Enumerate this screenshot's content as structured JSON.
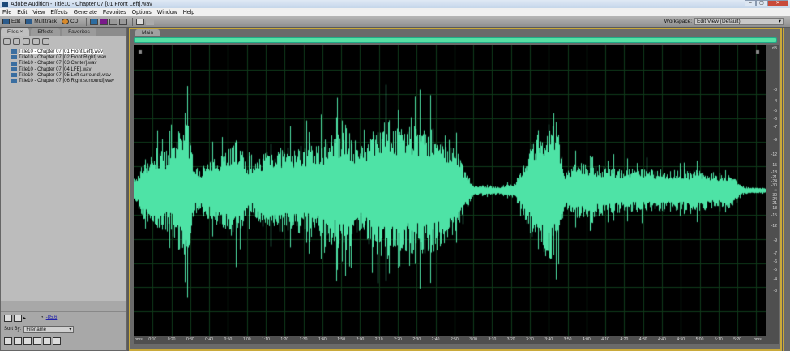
{
  "window": {
    "title": "Adobe Audition - Title10 - Chapter 07 [01 Front Left].wav",
    "controls": [
      "–",
      "▢",
      "✕"
    ]
  },
  "menu": [
    "File",
    "Edit",
    "View",
    "Effects",
    "Generate",
    "Favorites",
    "Options",
    "Window",
    "Help"
  ],
  "toolbar": {
    "edit": "Edit",
    "multitrack": "Multitrack",
    "cd": "CD",
    "workspace_label": "Workspace:",
    "workspace_value": "Edit View (Default)"
  },
  "left_panel": {
    "tabs": [
      "Files ×",
      "Effects",
      "Favorites"
    ],
    "files": [
      "Title10 - Chapter 07 [01 Front Left].wav",
      "Title10 - Chapter 07 [02 Front Right].wav",
      "Title10 - Chapter 07 [03 Center].wav",
      "Title10 - Chapter 07 [04 LFE].wav",
      "Title10 - Chapter 07 [05 Left surround].wav",
      "Title10 - Chapter 07 [06 Right surround].wav"
    ],
    "volume": "-85.6",
    "sort_label": "Sort By:",
    "sort_value": "Filename"
  },
  "main_panel": {
    "tab": "Main"
  },
  "chart_data": {
    "type": "area",
    "title": "Waveform",
    "x_unit": "seconds",
    "envelope": [
      [
        0,
        0.05
      ],
      [
        5,
        0.2
      ],
      [
        10,
        0.25
      ],
      [
        20,
        0.3
      ],
      [
        28,
        0.55
      ],
      [
        32,
        0.15
      ],
      [
        40,
        0.2
      ],
      [
        48,
        0.3
      ],
      [
        55,
        0.35
      ],
      [
        62,
        0.15
      ],
      [
        70,
        0.3
      ],
      [
        80,
        0.3
      ],
      [
        90,
        0.3
      ],
      [
        100,
        0.35
      ],
      [
        112,
        0.45
      ],
      [
        120,
        0.3
      ],
      [
        130,
        0.5
      ],
      [
        145,
        0.45
      ],
      [
        155,
        0.45
      ],
      [
        165,
        0.4
      ],
      [
        172,
        0.25
      ],
      [
        180,
        0.03
      ],
      [
        195,
        0.02
      ],
      [
        202,
        0.05
      ],
      [
        210,
        0.3
      ],
      [
        215,
        0.45
      ],
      [
        220,
        0.5
      ],
      [
        225,
        0.4
      ],
      [
        228,
        0.12
      ],
      [
        235,
        0.2
      ],
      [
        260,
        0.15
      ],
      [
        300,
        0.14
      ],
      [
        318,
        0.1
      ],
      [
        322,
        0.02
      ],
      [
        335,
        0.01
      ]
    ],
    "xlim": [
      0,
      335
    ],
    "time_ticks": [
      "hms",
      "0:10",
      "0:20",
      "0:30",
      "0:40",
      "0:50",
      "1:00",
      "1:10",
      "1:20",
      "1:30",
      "1:40",
      "1:50",
      "2:00",
      "2:10",
      "2:20",
      "2:30",
      "2:40",
      "2:50",
      "3:00",
      "3:10",
      "3:20",
      "3:30",
      "3:40",
      "3:50",
      "4:00",
      "4:10",
      "4:20",
      "4:30",
      "4:40",
      "4:50",
      "5:00",
      "5:10",
      "5:20",
      "hms"
    ],
    "db_ticks": [
      "dB",
      "-3",
      "-4",
      "-5",
      "-6",
      "-7",
      "-9",
      "-12",
      "-15",
      "-18",
      "-21",
      "-24",
      "-30",
      "-∞",
      "-30",
      "-24",
      "-21",
      "-18",
      "-15",
      "-12",
      "-9",
      "-7",
      "-6",
      "-5",
      "-4",
      "-3"
    ],
    "color": "#4ee3a6"
  }
}
